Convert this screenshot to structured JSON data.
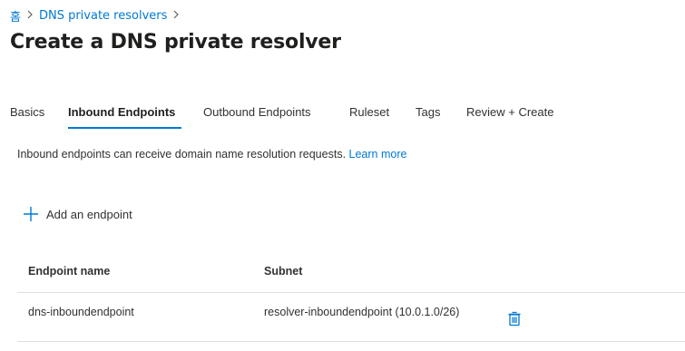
{
  "breadcrumb": {
    "home": "홈",
    "items": [
      "DNS private resolvers"
    ]
  },
  "page": {
    "title": "Create a DNS private resolver",
    "more_label": "···"
  },
  "tabs": [
    {
      "label": "Basics",
      "active": false
    },
    {
      "label": "Inbound Endpoints",
      "active": true
    },
    {
      "label": "Outbound Endpoints",
      "active": false
    },
    {
      "label": "Ruleset",
      "active": false
    },
    {
      "label": "Tags",
      "active": false
    },
    {
      "label": "Review + Create",
      "active": false
    }
  ],
  "description": {
    "text": "Inbound endpoints can receive domain name resolution requests.",
    "link": "Learn more"
  },
  "add_endpoint": {
    "label": "Add an endpoint",
    "icon": "plus-icon"
  },
  "table": {
    "columns": [
      "Endpoint name",
      "Subnet"
    ],
    "rows": [
      {
        "name": "dns-inboundendpoint",
        "subnet": "resolver-inboundendpoint (10.0.1.0/26)",
        "action_icon": "delete-icon"
      }
    ]
  },
  "colors": {
    "accent": "#0078d4",
    "text": "#323130",
    "divider": "#e1dfdd"
  }
}
